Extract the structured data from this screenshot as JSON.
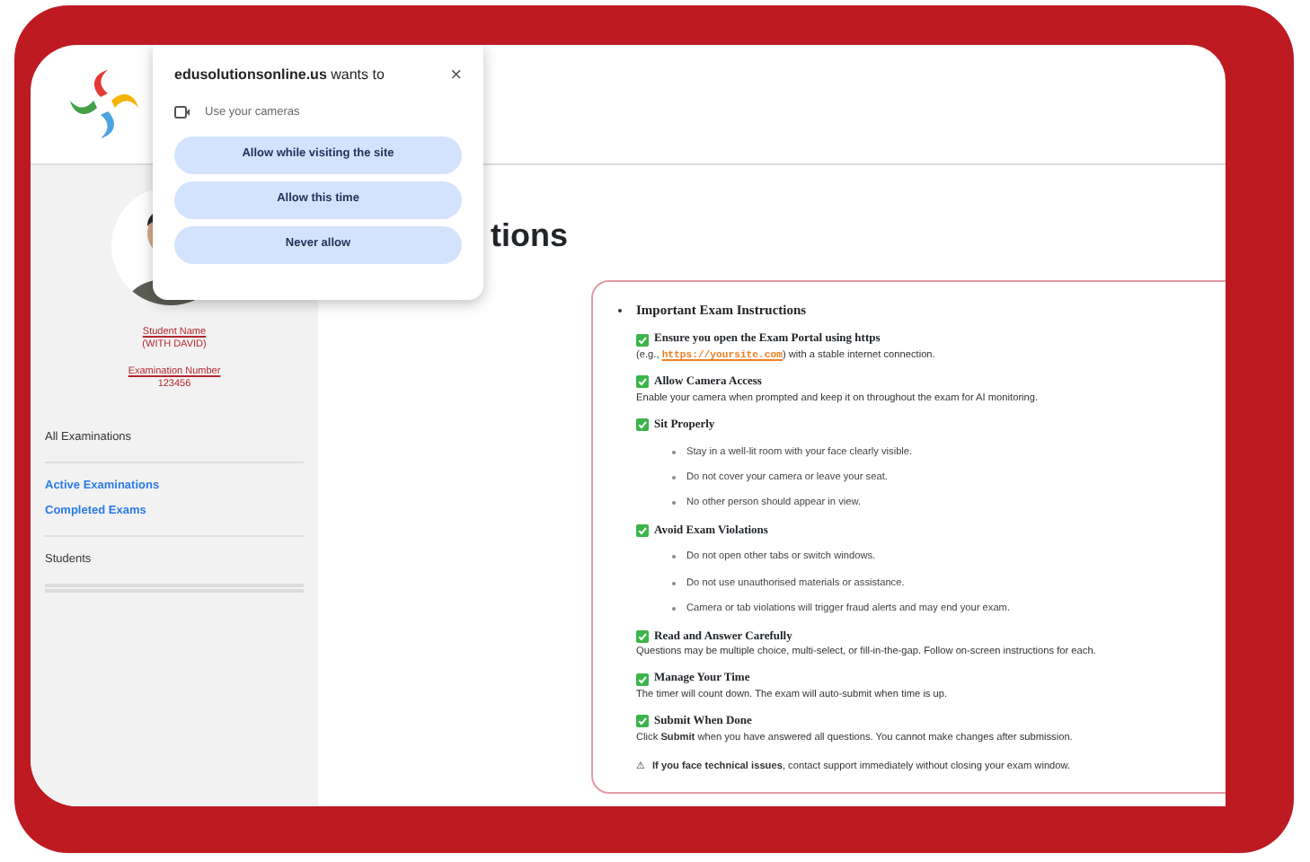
{
  "popup": {
    "site": "edusolutionsonline.us",
    "title_rest": "wants to",
    "close": "×",
    "permission": "Use your cameras",
    "buttons": [
      "Allow while visiting the site",
      "Allow this time",
      "Never allow"
    ]
  },
  "sidebar": {
    "student_name_label": "Student Name",
    "student_name": "(WITH DAVID)",
    "exam_number_label": "Examination Number",
    "exam_number": "123456",
    "groups": [
      {
        "items": [
          {
            "label": "All Examinations",
            "kind": "plain"
          }
        ]
      },
      {
        "items": [
          {
            "label": "Active Examinations",
            "kind": "link"
          },
          {
            "label": "Completed Exams",
            "kind": "link"
          }
        ]
      },
      {
        "items": [
          {
            "label": "Students",
            "kind": "plain"
          }
        ]
      }
    ]
  },
  "heading": "tions",
  "instructions": {
    "title": "Important Exam Instructions",
    "sections": [
      {
        "title": "Ensure you open the Exam Portal using https",
        "text_before": "(e.g., ",
        "link": "https://yoursite.com",
        "text_after": ") with a stable internet connection."
      },
      {
        "title": "Allow Camera Access",
        "text": "Enable your camera when prompted and keep it on throughout the exam for AI monitoring."
      },
      {
        "title": "Sit Properly",
        "bullets": [
          "Stay in a well-lit room with your face clearly visible.",
          "Do not cover your camera or leave your seat.",
          "No other person should appear in view."
        ]
      },
      {
        "title": "Avoid Exam Violations",
        "bullets": [
          "Do not open other tabs or switch windows.",
          "Do not use unauthorised materials or assistance.",
          "Camera or tab violations will trigger fraud alerts and may end your exam."
        ]
      },
      {
        "title": "Read and Answer Carefully",
        "text": "Questions may be multiple choice, multi-select, or fill-in-the-gap. Follow on-screen instructions for each."
      },
      {
        "title": "Manage Your Time",
        "text": "The timer will count down. The exam will auto-submit when time is up."
      },
      {
        "title": "Submit When Done",
        "text": "Click **Submit** when you have answered all questions. You cannot make changes after submission."
      }
    ],
    "note_icon": "⚠",
    "note": "**If you face technical issues**, contact support immediately without closing your exam window."
  }
}
